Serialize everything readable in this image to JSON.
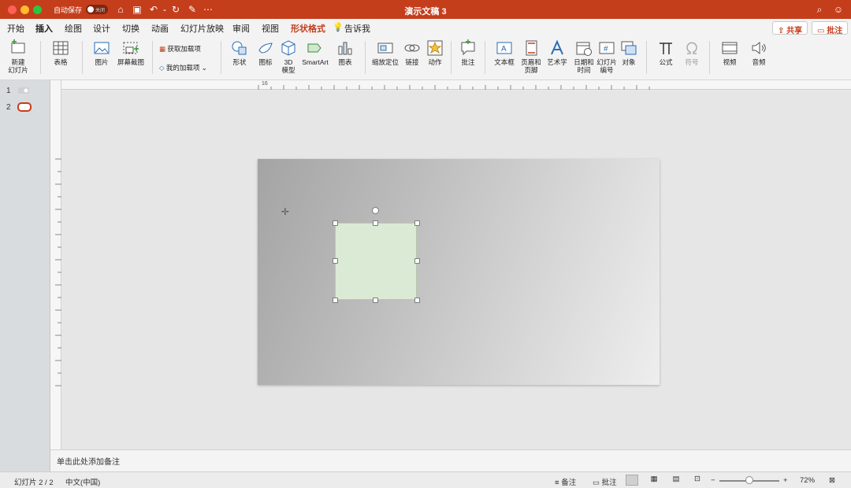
{
  "titlebar": {
    "autosave_label": "自动保存",
    "autosave_state": "关闭",
    "title": "演示文稿 3"
  },
  "tabs": [
    "开始",
    "插入",
    "绘图",
    "设计",
    "切换",
    "动画",
    "幻灯片放映",
    "审阅",
    "视图",
    "形状格式",
    "告诉我"
  ],
  "active_tab": "插入",
  "contextual_tab": "形状格式",
  "top_right": {
    "share_label": "共享",
    "comment_label": "批注"
  },
  "ribbon": {
    "new_slide": "新建\n幻灯片",
    "table": "表格",
    "picture": "图片",
    "screenshot": "屏幕截图",
    "get_addins": "获取加载项",
    "my_addins": "我的加载项",
    "shapes": "形状",
    "icons": "图标",
    "model3d": "3D\n模型",
    "smartart": "SmartArt",
    "chart": "图表",
    "zoom": "缩放定位",
    "link": "链接",
    "action": "动作",
    "comment": "批注",
    "textbox": "文本框",
    "header_footer": "页眉和\n页脚",
    "wordart": "艺术字",
    "datetime": "日期和\n时间",
    "slide_number": "幻灯片\n编号",
    "object": "对象",
    "equation": "公式",
    "symbol": "符号",
    "video": "视频",
    "audio": "音频"
  },
  "thumbnails": {
    "n1": "1",
    "n2": "2"
  },
  "notes_placeholder": "单击此处添加备注",
  "status": {
    "slide_info": "幻灯片 2 / 2",
    "language": "中文(中国)",
    "notes_btn": "备注",
    "comments_btn": "批注",
    "zoom": "72%",
    "zoom_level": 0.5
  },
  "ruler_top_left_number": "16",
  "colors": {
    "accent": "#c43e1c",
    "shape_fill": "#dbead4"
  }
}
